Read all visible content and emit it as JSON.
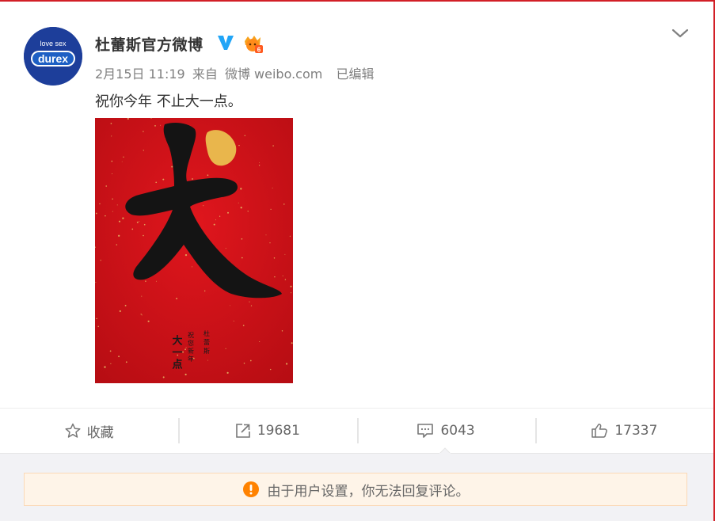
{
  "post": {
    "user_name": "杜蕾斯官方微博",
    "date": "2月15日 11:19",
    "source_prefix": "来自",
    "source": "微博 weibo.com",
    "edited": "已编辑",
    "text": "祝你今年 不止大一点。",
    "avatar": {
      "line1": "love sex",
      "line2": "durex"
    },
    "image": {
      "big_char": "大",
      "col1": "大一点",
      "col2": "祝您新年",
      "col3": "杜蕾斯",
      "background": "#d0141b"
    }
  },
  "actions": {
    "favorite_label": "收藏",
    "repost_count": "19681",
    "comment_count": "6043",
    "like_count": "17337"
  },
  "notice": {
    "text": "由于用户设置，你无法回复评论。"
  },
  "colors": {
    "accent": "#ff8200",
    "verified": "#21a5f7",
    "frame": "#d21f26"
  },
  "icons": [
    "chevron-down-icon",
    "verified-icon",
    "member-icon",
    "star-icon",
    "share-icon",
    "comment-icon",
    "thumb-up-icon",
    "warning-icon"
  ]
}
